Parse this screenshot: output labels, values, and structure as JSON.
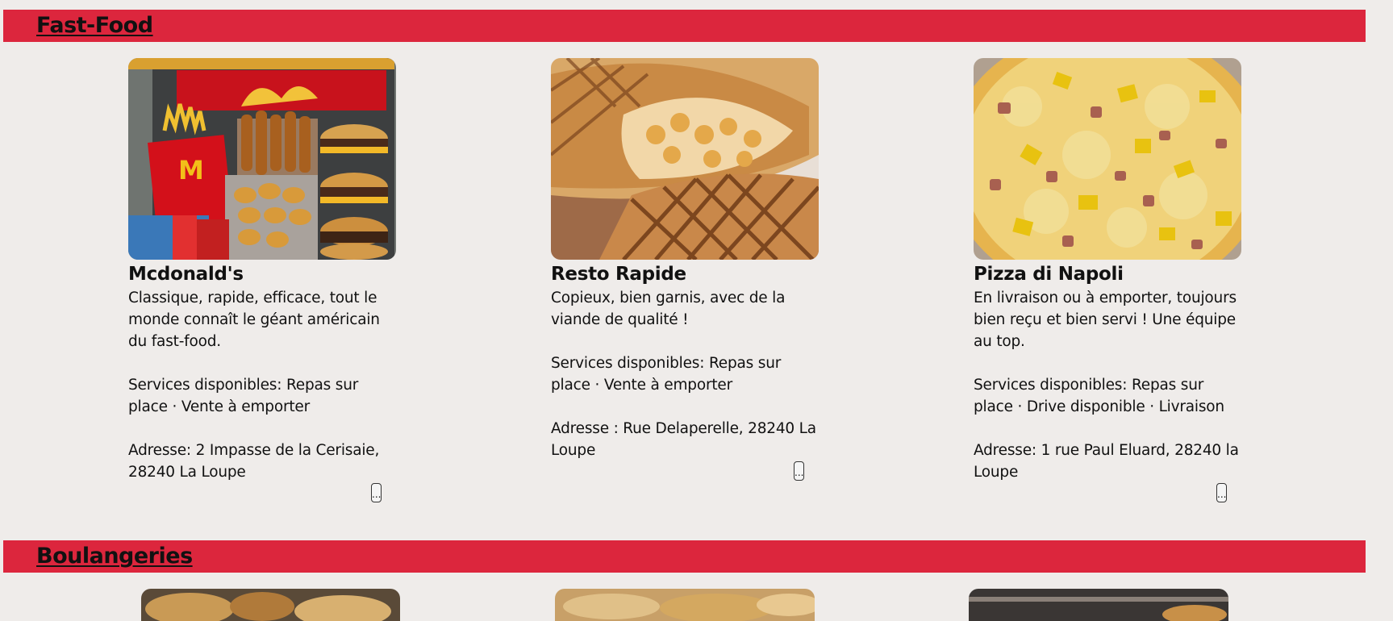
{
  "sections": [
    {
      "title": "Fast-Food",
      "cards": [
        {
          "name": "Mcdonald's",
          "description": "Classique, rapide, efficace, tout le monde connaît le géant américain du fast-food.",
          "services": "Services disponibles: Repas sur place · Vente à emporter",
          "address": "Adresse: 2 Impasse de la Cerisaie, 28240 La Loupe",
          "more_label": "...",
          "image_icon": "mcdonalds-meal-photo"
        },
        {
          "name": "Resto Rapide",
          "description": "Copieux, bien garnis, avec de la viande de qualité !",
          "services": "Services disponibles: Repas sur place · Vente à emporter",
          "address": "Adresse : Rue Delaperelle, 28240 La Loupe",
          "more_label": "...",
          "image_icon": "panini-wrap-photo"
        },
        {
          "name": "Pizza di Napoli",
          "description": "En livraison ou à emporter, toujours bien reçu et bien servi ! Une équipe au top.",
          "services": "Services disponibles: Repas sur place · Drive disponible · Livraison",
          "address": "Adresse: 1 rue Paul Eluard, 28240 la Loupe",
          "more_label": "...",
          "image_icon": "pizza-photo"
        }
      ]
    },
    {
      "title": "Boulangeries"
    }
  ],
  "colors": {
    "section_bar": "#dc263d",
    "background": "#efecea"
  }
}
